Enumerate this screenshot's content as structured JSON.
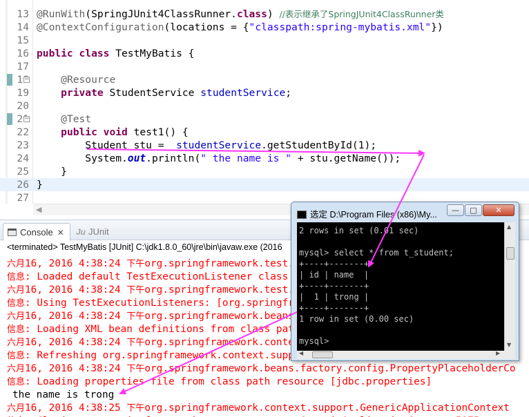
{
  "editor": {
    "lines": [
      {
        "num": "13",
        "html": "<span class=\"ann\">@RunWith</span>(SpringJUnit4ClassRunner.<span class=\"kw\">class</span>) <span class=\"cm\">//表示继承了SpringJUnit4ClassRunner类</span>"
      },
      {
        "num": "14",
        "html": "<span class=\"ann\">@ContextConfiguration</span>(locations = {<span class=\"str\">\"classpath:spring-mybatis.xml\"</span>})"
      },
      {
        "num": "15",
        "html": ""
      },
      {
        "num": "16",
        "html": "<span class=\"kw\">public</span> <span class=\"kw\">class</span> TestMyBatis {"
      },
      {
        "num": "17",
        "html": ""
      },
      {
        "num": "18",
        "html": "    <span class=\"ann\">@Resource</span>"
      },
      {
        "num": "19",
        "html": "    <span class=\"kw\">private</span> StudentService <span class=\"fld\">studentService</span>;"
      },
      {
        "num": "20",
        "html": ""
      },
      {
        "num": "21",
        "html": "    <span class=\"ann\">@Test</span>"
      },
      {
        "num": "22",
        "html": "    <span class=\"kw\">public</span> <span class=\"kw\">void</span> test1() {"
      },
      {
        "num": "23",
        "html": "        Student stu =  <span class=\"fld\">studentService</span>.getStudentById(1);"
      },
      {
        "num": "24",
        "html": "        System.<span class=\"sfld\">out</span>.println(<span class=\"str\">\" the name is \"</span> + stu.getName());"
      },
      {
        "num": "25",
        "html": "    }"
      },
      {
        "num": "26",
        "html": "}"
      },
      {
        "num": "27",
        "html": ""
      }
    ],
    "fold_marks": {
      "18": "−",
      "21": "−"
    }
  },
  "console": {
    "tab_console": "Console",
    "tab_junit": "JUnit",
    "terminated": "<terminated> TestMyBatis [JUnit] C:\\jdk1.8.0_60\\jre\\bin\\javaw.exe (2016",
    "lines": [
      {
        "cn": "六月",
        "text": "16, 2016 4:38:24 ",
        "cn2": "下午",
        "rest": "org.springframework.test.context.support.AbstractContextLoader"
      },
      {
        "cn": "信息",
        "text": ": Loaded default TestExecutionListener class names from location"
      },
      {
        "cn": "六月",
        "text": "16, 2016 4:38:24 ",
        "cn2": "下午",
        "rest": "org.springframework.test.context.support.DefaultTestContext"
      },
      {
        "cn": "信息",
        "text": ": Using TestExecutionListeners: [org.springframework.test.context.web.ServletT"
      },
      {
        "cn": "六月",
        "text": "16, 2016 4:38:24 ",
        "cn2": "下午",
        "rest": "org.springframework.beans.factory.xml.XmlBeanDefinitionReader"
      },
      {
        "cn": "信息",
        "text": ": Loading XML bean definitions from class path resource [spring-mybatis.xml]"
      },
      {
        "cn": "六月",
        "text": "16, 2016 4:38:24 ",
        "cn2": "下午",
        "rest": "org.springframework.context.support.GenericApplicationContext"
      },
      {
        "cn": "信息",
        "text": ": Refreshing org.springframework.context.support.GenericApplicationContext@5175"
      },
      {
        "cn": "六月",
        "text": "16, 2016 4:38:24 ",
        "cn2": "下午",
        "rest": "org.springframework.beans.factory.config.PropertyPlaceholderCo"
      },
      {
        "cn": "信息",
        "text": ": Loading properties file from class path resource [jdbc.properties]"
      },
      {
        "out": "the name is trong"
      },
      {
        "cn": "六月",
        "text": "16, 2016 4:38:25 ",
        "cn2": "下午",
        "rest": "org.springframework.context.support.GenericApplicationContext"
      },
      {
        "cn": "信息",
        "text": ": Closing org.springframework.context.support.GenericApplicationContext@5175"
      }
    ]
  },
  "cmd": {
    "title": "选定 D:\\Program Files (x86)\\My...",
    "min_label": "—",
    "max_label": "□",
    "close_label": "✕",
    "lines": [
      "2 rows in set (0.01 sec)",
      "",
      "mysql> select * from t_student;",
      "+----+-------+",
      "| id | name  |",
      "+----+-------+",
      "|  1 | trong |",
      "+----+-------+",
      "1 row in set (0.00 sec)",
      "",
      "mysql>"
    ]
  },
  "colors": {
    "arrow": "#ff33ff",
    "console_text": "#ff0000",
    "keyword": "#7f0055"
  }
}
